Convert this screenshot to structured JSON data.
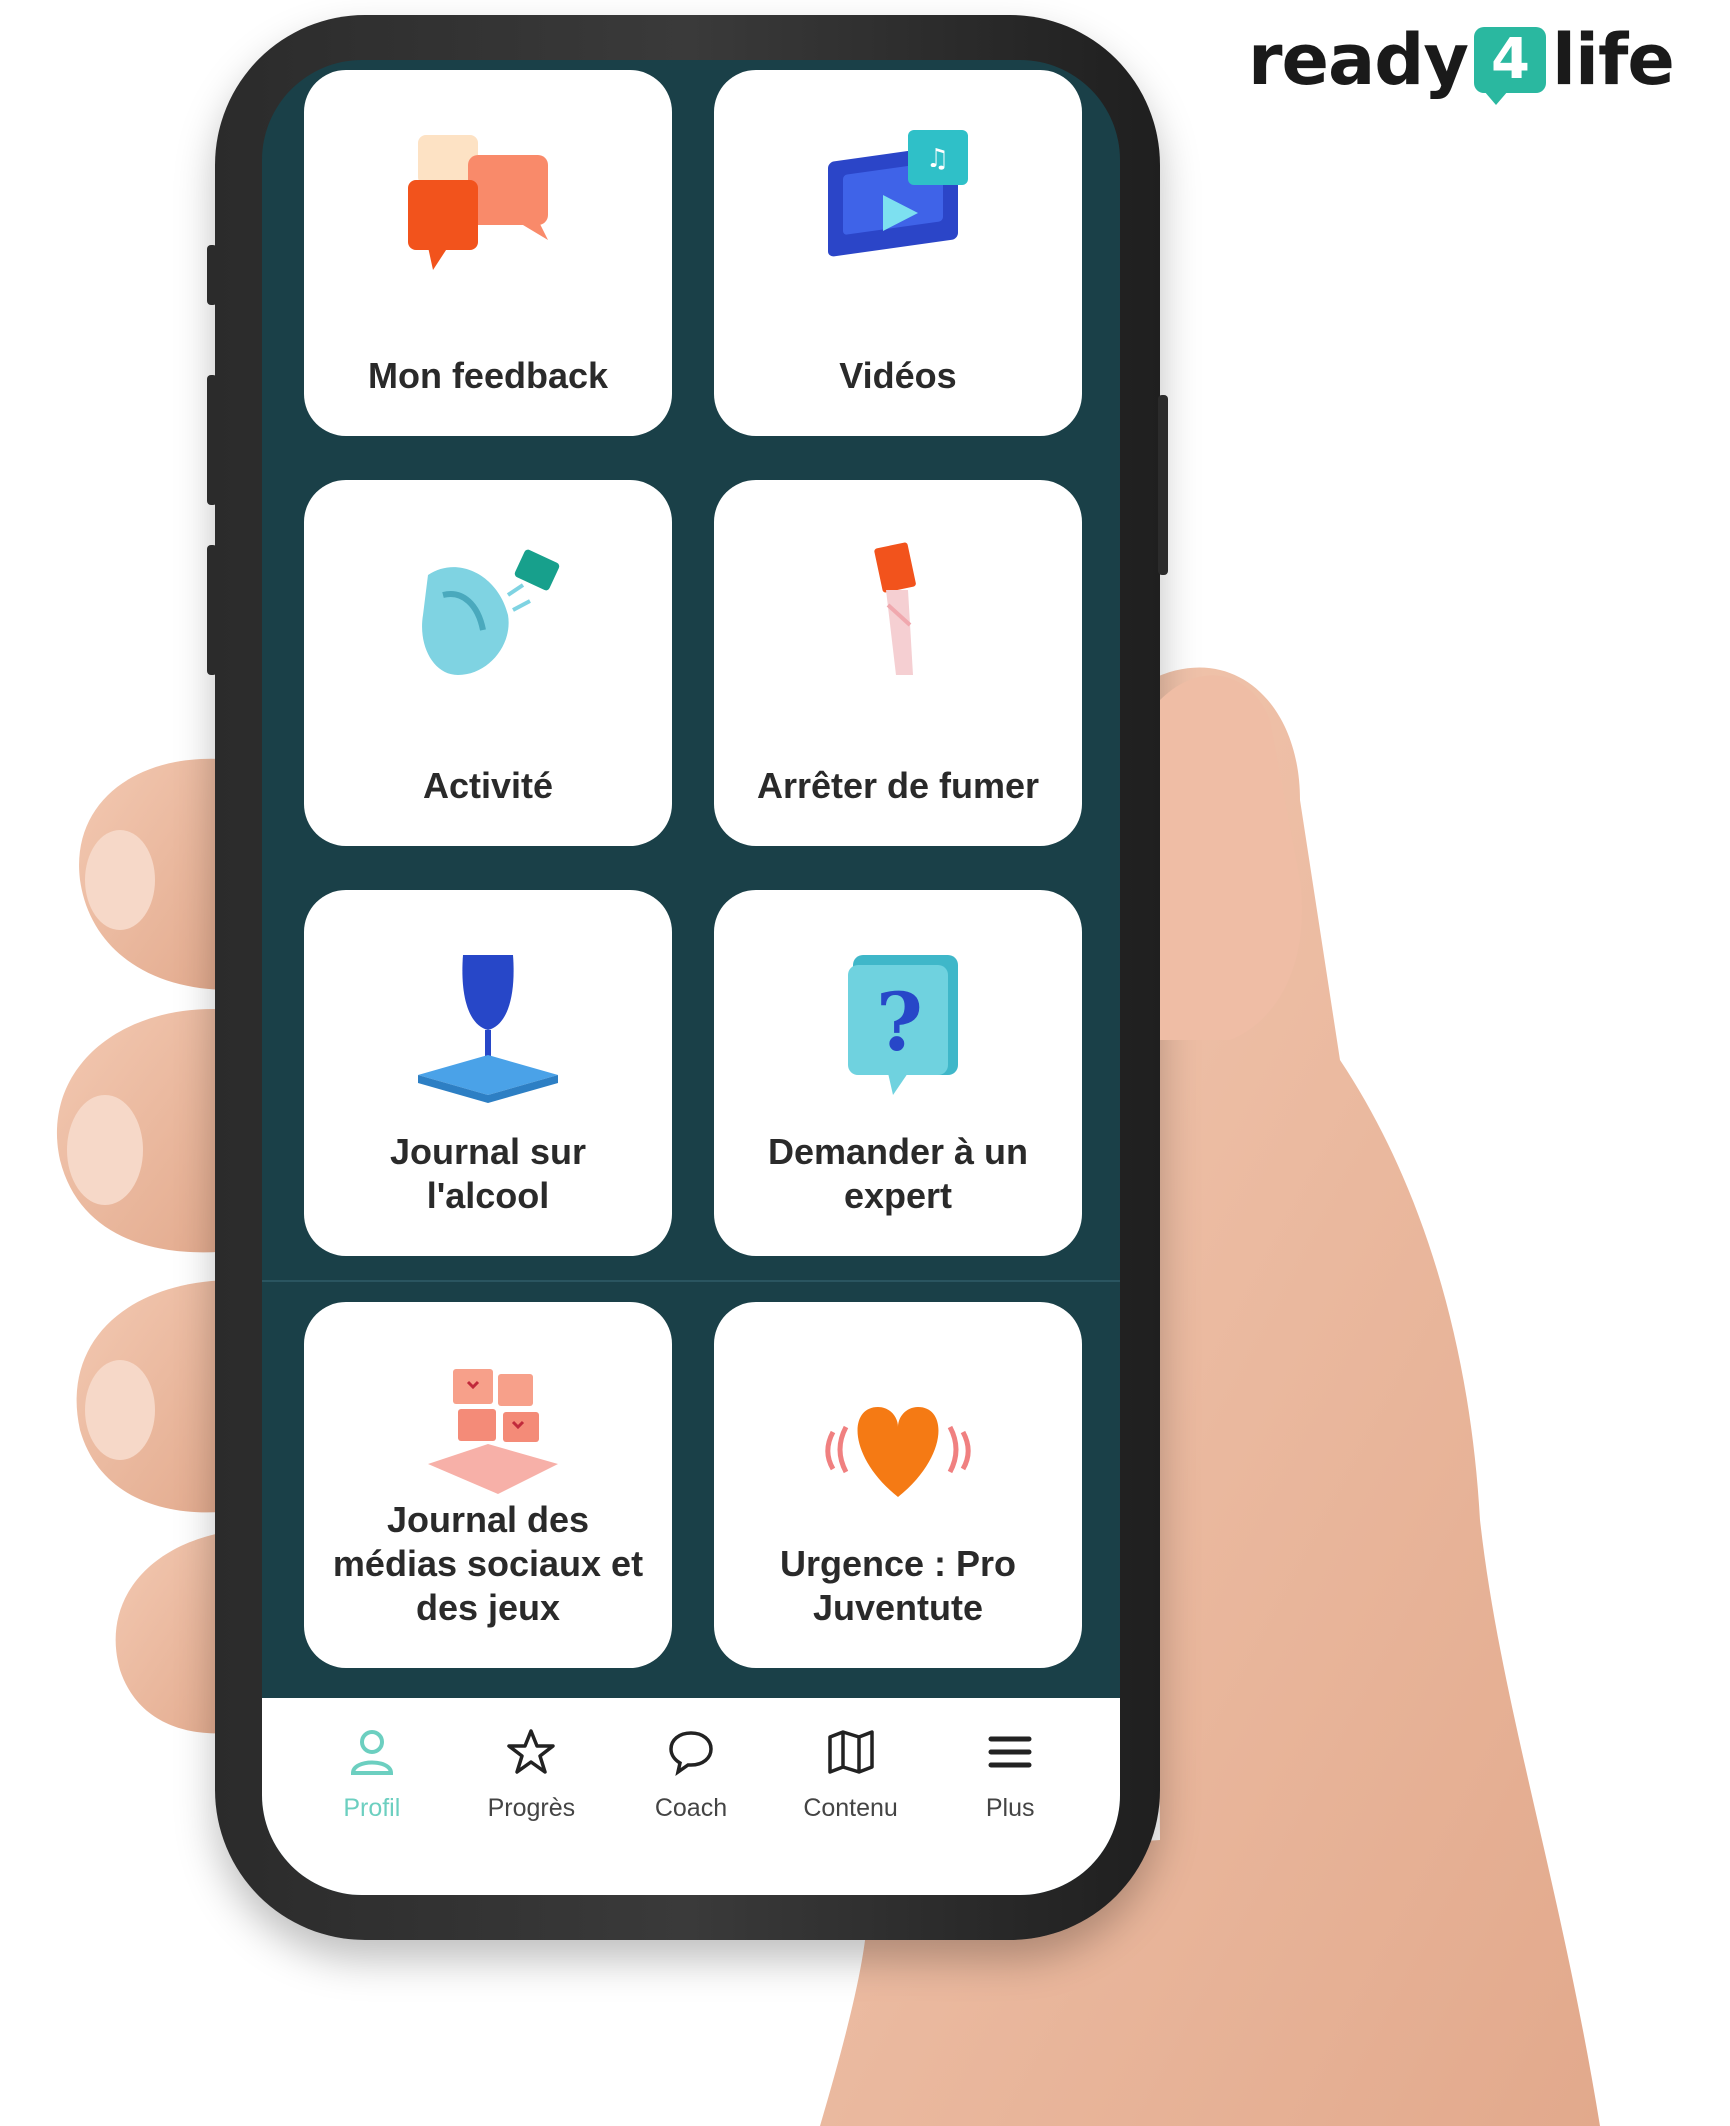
{
  "brand": {
    "prefix": "ready",
    "number": "4",
    "suffix": "life"
  },
  "colors": {
    "screen_bg": "#1a4048",
    "accent": "#2ab8a0",
    "active_nav": "#6ccfc0"
  },
  "tiles": [
    {
      "label": "Mon feedback",
      "icon": "chat-bubbles-icon"
    },
    {
      "label": "Vidéos",
      "icon": "video-icon"
    },
    {
      "label": "Activité",
      "icon": "sneaker-icon"
    },
    {
      "label": "Arrêter de fumer",
      "icon": "cigarette-icon"
    },
    {
      "label": "Journal sur\nl'alcool",
      "icon": "wine-glass-book-icon"
    },
    {
      "label": "Demander à un\nexpert",
      "icon": "question-bubble-icon"
    },
    {
      "label": "Journal des\nmédias sociaux et\ndes jeux",
      "icon": "social-media-icon"
    },
    {
      "label": "Urgence : Pro\nJuventute",
      "icon": "heart-icon"
    }
  ],
  "nav": {
    "active": "Profil",
    "items": [
      {
        "label": "Profil",
        "icon": "user-icon"
      },
      {
        "label": "Progrès",
        "icon": "star-icon"
      },
      {
        "label": "Coach",
        "icon": "chat-icon"
      },
      {
        "label": "Contenu",
        "icon": "map-icon"
      },
      {
        "label": "Plus",
        "icon": "menu-icon"
      }
    ]
  }
}
